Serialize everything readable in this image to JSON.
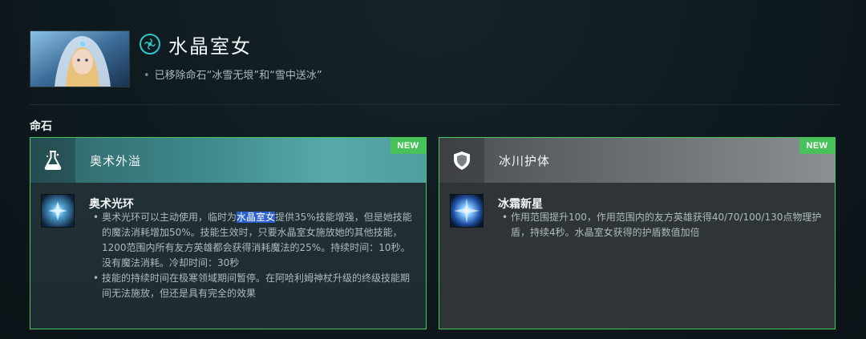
{
  "hero": {
    "name": "水晶室女",
    "note": "已移除命石“冰雪无垠”和“雪中送冰”",
    "attribute_icon": "universal-attribute-icon"
  },
  "section": {
    "label": "命石"
  },
  "cards": [
    {
      "title": "奥术外溢",
      "badge": "NEW",
      "head_icon": "flask-icon",
      "skill": {
        "name": "奥术光环",
        "bullets": [
          {
            "pre": "奥术光环可以主动使用，临时为",
            "highlight": "水晶室女",
            "post": "提供35%技能增强，但是她技能的魔法消耗增加50%。技能生效时，只要水晶室女施放她的其他技能，1200范围内所有友方英雄都会获得消耗魔法的25%。持续时间：10秒。没有魔法消耗。冷却时间：30秒"
          },
          {
            "text": "技能的持续时间在极寒领域期间暂停。在阿哈利姆神杖升级的终级技能期间无法施放，但还是具有完全的效果"
          }
        ]
      }
    },
    {
      "title": "冰川护体",
      "badge": "NEW",
      "head_icon": "shield-icon",
      "skill": {
        "name": "冰霜新星",
        "bullets": [
          {
            "text": "作用范围提升100，作用范围内的友方英雄获得40/70/100/130点物理护盾，持续4秒。水晶室女获得的护盾数值加倍"
          }
        ]
      }
    }
  ],
  "colors": {
    "accent_green": "#49c15a",
    "attribute_teal": "#2fc7c7",
    "highlight_blue": "#2b5fcf"
  }
}
